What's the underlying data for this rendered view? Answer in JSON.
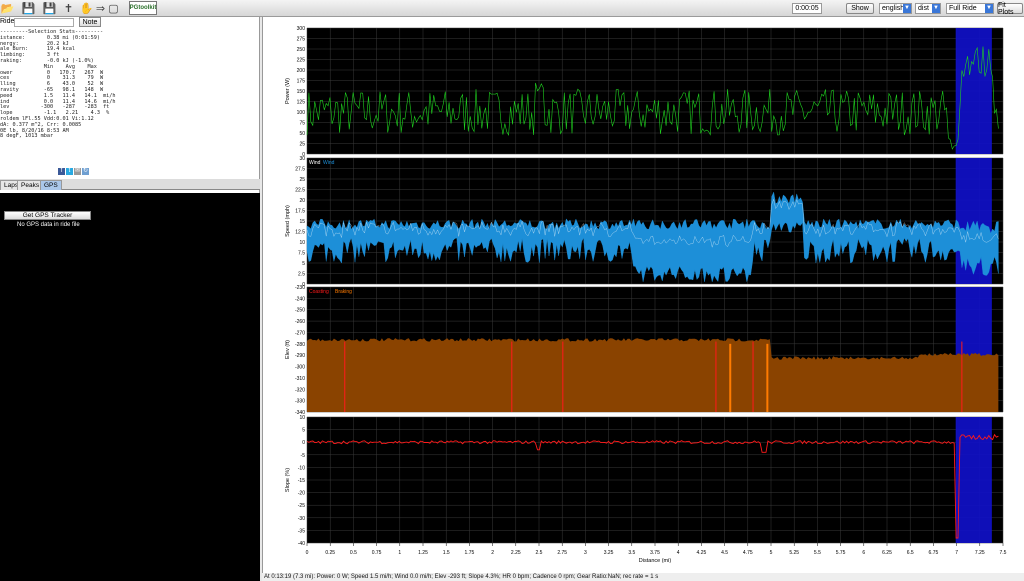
{
  "toolbar": {
    "icons": [
      "open-folder-icon",
      "save-icon",
      "save-as-icon",
      "probe-icon",
      "hand-pan-icon",
      "arrow-icon",
      "monitor-icon"
    ],
    "logo_label": "PGtoolkit",
    "time_value": "0:00:05",
    "show_label": "Show",
    "units_value": "english",
    "axis_value": "dist",
    "range_value": "Full Ride",
    "fit_label": "Fit Plots"
  },
  "ride": {
    "label": "Ride:",
    "value": "",
    "note_label": "Note"
  },
  "stats_text": "---------Selection Stats---------\nistance:       0.38 mi (0:01:59)\nnergy:         20.2 kJ\nale Burn:      19.4 kcal\nlimbing:       3 ft\nraking:        -0.0 kJ (-1.0%)\n              Min    Avg    Max\nower           0   170.7   267  W\nces            0    31.3    79  W\nlling          6    43.0    52  W\nravity        -65   98.1   148  W\npeed          1.5   11.4   14.1  mi/h\nind           0.0   11.4   14.6  mi/h\nlev          -300   -287   -283  ft\nlope          -1.1   2.21    4.3  %\nroldem lFl.55 Vdd:0.01 Vi:1.12\ndA: 0.377 m^2, Crr: 0.0085\n0E lb, 8/20/16 8:53 AM\n8 degF, 1013 mbar",
  "share_icons": [
    "facebook-icon",
    "twitter-icon",
    "email-icon",
    "share-icon"
  ],
  "tabs": [
    {
      "label": "Laps",
      "active": false
    },
    {
      "label": "Peaks",
      "active": false
    },
    {
      "label": "GPS",
      "active": true
    }
  ],
  "gps": {
    "button_label": "Get GPS Tracker",
    "message": "No GPS data in ride file"
  },
  "colors": {
    "plot_bg": "#000000",
    "power": "#1fd21f",
    "speed": "#1d8fd8",
    "wind": "#ffffff",
    "elev": "#8a4300",
    "coasting": "#ff1a1a",
    "braking": "#ff7b00",
    "slope": "#ff1a1a",
    "selection": "#1010c8"
  },
  "panels": [
    {
      "id": "power",
      "ylabel": "Power (W)",
      "ylim": [
        0,
        300
      ],
      "ticks": [
        "300",
        "275",
        "250",
        "225",
        "200",
        "175",
        "150",
        "125",
        "100",
        "75",
        "50",
        "25",
        "0"
      ],
      "legend": []
    },
    {
      "id": "speed",
      "ylabel": "Speed (mph)",
      "ylim": [
        0,
        30
      ],
      "ticks": [
        "30",
        "27.5",
        "25",
        "22.5",
        "20",
        "17.5",
        "15",
        "12.5",
        "10",
        "7.5",
        "5",
        "2.5",
        "0"
      ],
      "legend": [
        {
          "text": "Wind",
          "color": "#ffffff"
        },
        {
          "text": "Wind",
          "color": "#1d8fd8"
        }
      ]
    },
    {
      "id": "elev",
      "ylabel": "Elev (ft)",
      "ylim": [
        -340,
        -230
      ],
      "ticks": [
        "-230",
        "-240",
        "-250",
        "-260",
        "-270",
        "-280",
        "-290",
        "-300",
        "-310",
        "-320",
        "-330",
        "-340"
      ],
      "legend": [
        {
          "text": "Coasting",
          "color": "#ff1a1a"
        },
        {
          "text": "Braking",
          "color": "#ff7b00"
        }
      ]
    },
    {
      "id": "slope",
      "ylabel": "Slope (%)",
      "ylim": [
        -40,
        10
      ],
      "ticks": [
        "10",
        "5",
        "0",
        "-5",
        "-10",
        "-15",
        "-20",
        "-25",
        "-30",
        "-35",
        "-40"
      ],
      "legend": []
    }
  ],
  "x_axis": {
    "label": "Distance (mi)",
    "range": [
      0,
      7.5
    ],
    "ticks": [
      "0",
      "0.25",
      "0.5",
      "0.75",
      "1",
      "1.25",
      "1.5",
      "1.75",
      "2",
      "2.25",
      "2.5",
      "2.75",
      "3",
      "3.25",
      "3.5",
      "3.75",
      "4",
      "4.25",
      "4.5",
      "4.75",
      "5",
      "5.25",
      "5.5",
      "5.75",
      "6",
      "6.25",
      "6.5",
      "6.75",
      "7",
      "7.25",
      "7.5"
    ]
  },
  "selection": {
    "start_mi": 6.99,
    "end_mi": 7.38
  },
  "status_text": "At 0:13:19 (7.3 mi): Power: 0 W; Speed 1.5 mi/h; Wind 0.0 mi/h; Elev -293 ft; Slope 4.3%; HR 0 bpm; Cadence 0 rpm; Gear Ratio:NaN; rec rate = 1 s"
}
